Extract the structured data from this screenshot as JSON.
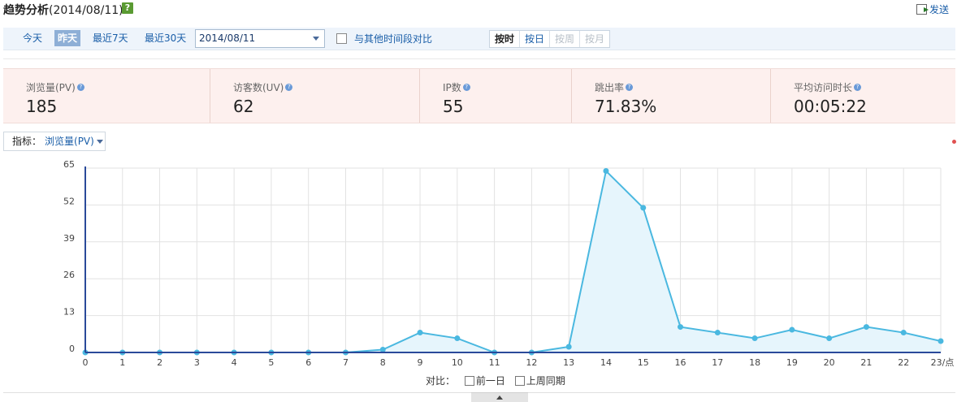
{
  "header": {
    "title": "趋势分析",
    "date_suffix": "(2014/08/11)",
    "help_glyph": "?",
    "send_label": "发送"
  },
  "toolbar": {
    "quick_ranges": [
      "今天",
      "昨天",
      "最近7天",
      "最近30天"
    ],
    "active_range": "昨天",
    "date_value": "2014/08/11",
    "compare_label": "与其他时间段对比",
    "granularity": [
      "按时",
      "按日",
      "按周",
      "按月"
    ],
    "active_granularity": "按时",
    "disabled_granularity": [
      "按周",
      "按月"
    ]
  },
  "metrics": [
    {
      "label": "浏览量(PV)",
      "value": "185"
    },
    {
      "label": "访客数(UV)",
      "value": "62"
    },
    {
      "label": "IP数",
      "value": "55"
    },
    {
      "label": "跳出率",
      "value": "71.83%"
    },
    {
      "label": "平均访问时长",
      "value": "00:05:22"
    }
  ],
  "indicator": {
    "label": "指标：",
    "value": "浏览量(PV)"
  },
  "legend": {
    "label": "对比：",
    "options": [
      "前一日",
      "上周同期"
    ]
  },
  "colors": {
    "line": "#4ab8e0",
    "area": "#e6f5fc",
    "axis": "#2a4a9a",
    "grid": "#e2e2e2"
  },
  "chart_data": {
    "type": "area",
    "x": [
      "0",
      "1",
      "2",
      "3",
      "4",
      "5",
      "6",
      "7",
      "8",
      "9",
      "10",
      "11",
      "12",
      "13",
      "14",
      "15",
      "16",
      "17",
      "18",
      "19",
      "20",
      "21",
      "22",
      "23/点"
    ],
    "series": [
      {
        "values": [
          0,
          0,
          0,
          0,
          0,
          0,
          0,
          0,
          1,
          7,
          5,
          0,
          0,
          2,
          64,
          51,
          9,
          7,
          5,
          8,
          5,
          9,
          7,
          4
        ]
      }
    ],
    "y_ticks": [
      0,
      13,
      26,
      39,
      52,
      65
    ],
    "ylim": [
      0,
      65
    ],
    "grid": true
  }
}
